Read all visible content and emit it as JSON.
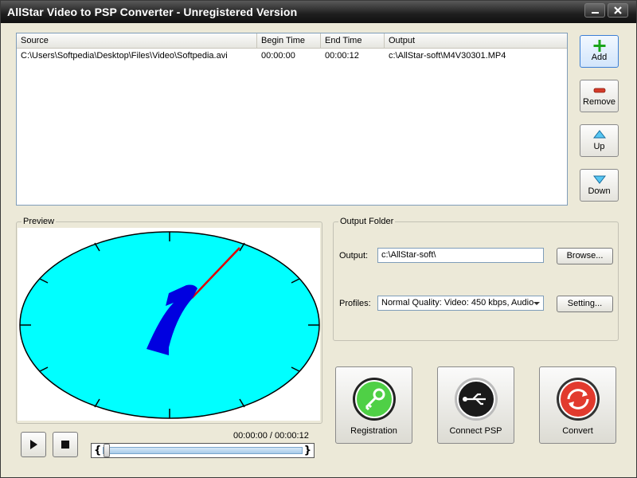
{
  "window": {
    "title": "AllStar Video to PSP Converter - Unregistered Version",
    "min_icon": "minimize-icon",
    "close_icon": "close-icon"
  },
  "file_list": {
    "columns": [
      "Source",
      "Begin Time",
      "End Time",
      "Output"
    ],
    "rows": [
      {
        "source": "C:\\Users\\Softpedia\\Desktop\\Files\\Video\\Softpedia.avi",
        "begin": "00:00:00",
        "end": "00:00:12",
        "output": "c:\\AllStar-soft\\M4V30301.MP4"
      }
    ]
  },
  "side_buttons": {
    "add": "Add",
    "remove": "Remove",
    "up": "Up",
    "down": "Down"
  },
  "preview": {
    "title": "Preview",
    "clock_colors": {
      "face": "#00ffff",
      "hand_blue": "#0000e0",
      "hand_red": "#e00000"
    }
  },
  "output_folder": {
    "title": "Output Folder",
    "output_label": "Output:",
    "output_value": "c:\\AllStar-soft\\",
    "browse_label": "Browse...",
    "profiles_label": "Profiles:",
    "profile_value": "Normal Quality: Video: 450 kbps, Audio",
    "setting_label": "Setting..."
  },
  "actions": {
    "registration": "Registration",
    "connect_psp": "Connect PSP",
    "convert": "Convert"
  },
  "playback": {
    "time": "00:00:00 / 00:00:12",
    "position_fraction": 0.0,
    "left_brace": "{",
    "right_brace": "}"
  }
}
